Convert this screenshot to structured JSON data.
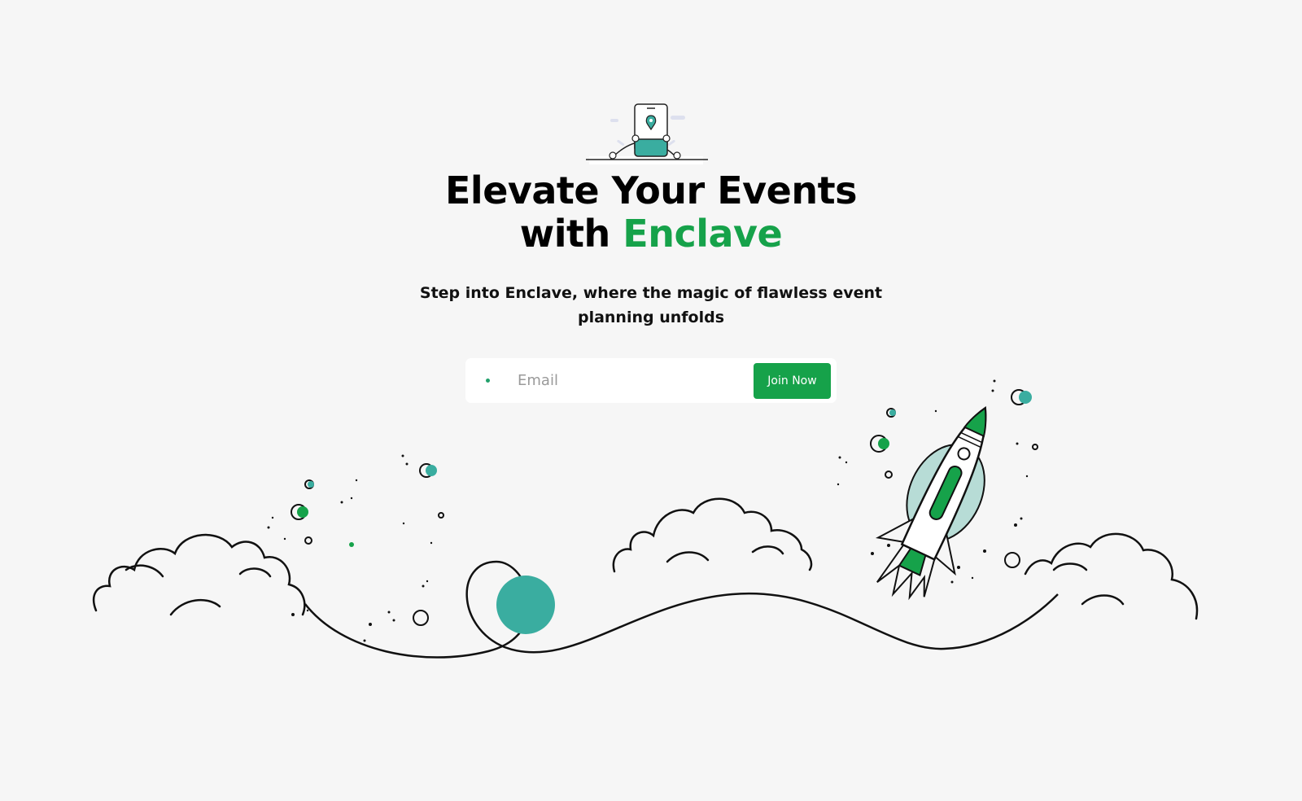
{
  "hero": {
    "headline_line1": "Elevate Your Events",
    "headline_prefix": "with ",
    "headline_brand": "Enclave",
    "subtitle": "Step into Enclave, where the magic of flawless event planning unfolds"
  },
  "signup": {
    "email_placeholder": "Email",
    "email_value": "",
    "join_label": "Join Now"
  },
  "colors": {
    "brand_green": "#16a24a",
    "teal": "#3aada0",
    "background": "#f6f6f6"
  },
  "icons": {
    "hero": "phone-location-pin-illustration",
    "field": "dot-icon",
    "scene": "rocket-launch-illustration"
  }
}
